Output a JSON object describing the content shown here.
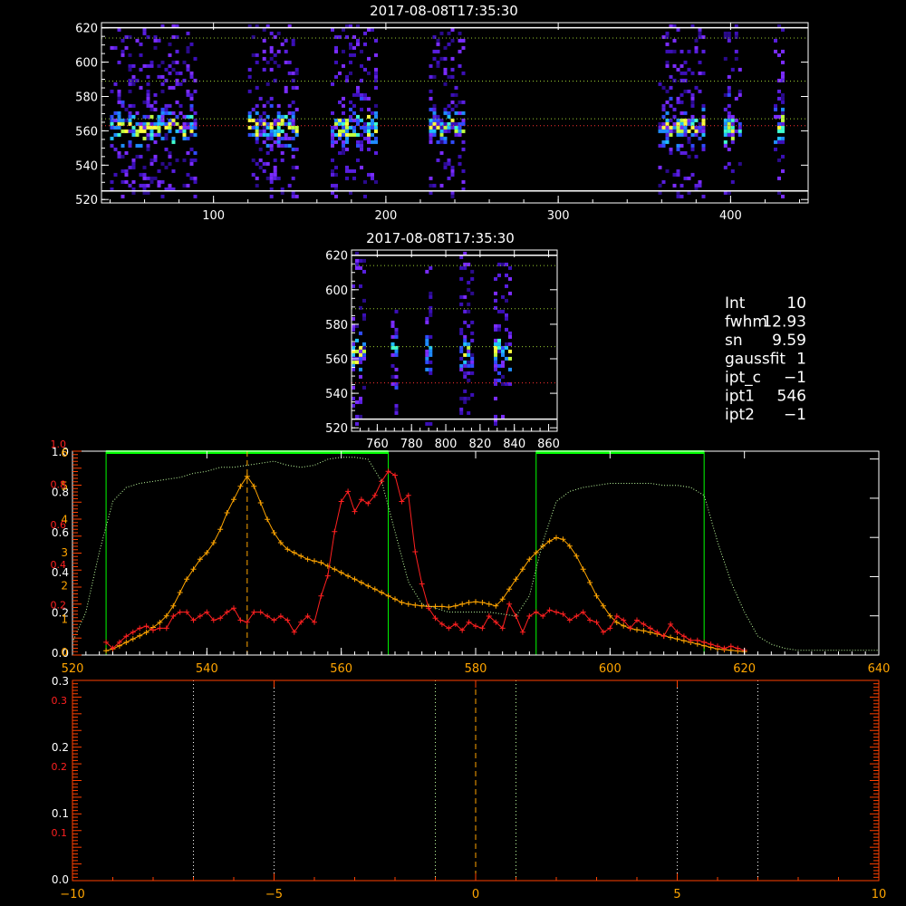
{
  "panel_top": {
    "title": "2017-08-08T17:35:30",
    "xticks": [
      "100",
      "200",
      "300",
      "400"
    ],
    "yticks": [
      "520",
      "540",
      "560",
      "580",
      "600",
      "620"
    ]
  },
  "panel_mid": {
    "title": "2017-08-08T17:35:30",
    "xticks": [
      "760",
      "780",
      "800",
      "820",
      "840",
      "860"
    ],
    "yticks": [
      "520",
      "540",
      "560",
      "580",
      "600",
      "620"
    ]
  },
  "fit_info": [
    {
      "key": "Int",
      "val": "10"
    },
    {
      "key": "fwhm",
      "val": "12.93"
    },
    {
      "key": "sn",
      "val": "9.59"
    },
    {
      "key": "gaussfit",
      "val": "1"
    },
    {
      "key": "ipt_c",
      "val": "−1"
    },
    {
      "key": "ipt1",
      "val": "546"
    },
    {
      "key": "ipt2",
      "val": "−1"
    }
  ],
  "colors": {
    "white": "#ffffff",
    "orange": "#ffa500",
    "red": "#ff2020",
    "green": "#00ff00",
    "lightgreen": "#c0ffa0",
    "axis_red": "#ff4000"
  },
  "chart_data": [
    {
      "type": "heatmap",
      "title": "2017-08-08T17:35:30",
      "xlim": [
        35,
        445
      ],
      "ylim": [
        518,
        623
      ],
      "signal_bands_x": [
        [
          40,
          90
        ],
        [
          120,
          148
        ],
        [
          168,
          195
        ],
        [
          225,
          245
        ],
        [
          358,
          385
        ],
        [
          396,
          405
        ],
        [
          425,
          430
        ]
      ],
      "horizontal_lines": {
        "white_solid": [
          620,
          525
        ],
        "green_dotted": [
          614,
          589,
          567
        ],
        "red_dotted": [
          563
        ]
      }
    },
    {
      "type": "heatmap",
      "title": "2017-08-08T17:35:30",
      "xlim": [
        745,
        865
      ],
      "ylim": [
        518,
        623
      ],
      "signal_bands_x": [
        [
          745,
          752
        ],
        [
          768,
          772
        ],
        [
          788,
          792
        ],
        [
          808,
          815
        ],
        [
          828,
          838
        ]
      ],
      "horizontal_lines": {
        "white_solid": [
          620,
          525
        ],
        "green_dotted": [
          614,
          589,
          567
        ],
        "red_dotted": [
          546
        ]
      }
    },
    {
      "type": "line",
      "xlim": [
        520,
        640
      ],
      "xticks": [
        "520",
        "540",
        "560",
        "580",
        "600",
        "620",
        "640"
      ],
      "left_axis_white": [
        "0.0",
        "0.2",
        "0.4",
        "0.6",
        "0.8",
        "1.0"
      ],
      "left_axis_orange": [
        "0",
        "1",
        "2",
        "3",
        "4",
        "5",
        "6"
      ],
      "left_axis_red": [
        "0.2",
        "0.4",
        "0.6",
        "0.8",
        "1.0"
      ],
      "vertical_green_lines": [
        525,
        567,
        589,
        614
      ],
      "vertical_orange_dashed": 546,
      "series": [
        {
          "color": "orange",
          "x": [
            525,
            526,
            527,
            528,
            529,
            530,
            531,
            532,
            533,
            534,
            535,
            536,
            537,
            538,
            539,
            540,
            541,
            542,
            543,
            544,
            545,
            546,
            547,
            548,
            549,
            550,
            551,
            552,
            553,
            554,
            555,
            556,
            557,
            558,
            559,
            560,
            561,
            562,
            563,
            564,
            565,
            566,
            567,
            568,
            569,
            570,
            571,
            572,
            573,
            574,
            575,
            576,
            577,
            578,
            579,
            580,
            581,
            582,
            583,
            584,
            585,
            586,
            587,
            588,
            589,
            590,
            591,
            592,
            593,
            594,
            595,
            596,
            597,
            598,
            599,
            600,
            601,
            602,
            603,
            604,
            605,
            606,
            607,
            608,
            609,
            610,
            611,
            612,
            613,
            614,
            615,
            616,
            617,
            618,
            619,
            620
          ],
          "y": [
            0.05,
            0.1,
            0.2,
            0.3,
            0.4,
            0.5,
            0.6,
            0.75,
            0.9,
            1.1,
            1.4,
            1.8,
            2.2,
            2.5,
            2.8,
            3.0,
            3.3,
            3.7,
            4.2,
            4.6,
            5.0,
            5.3,
            5.0,
            4.5,
            4.0,
            3.6,
            3.3,
            3.1,
            3.0,
            2.9,
            2.8,
            2.75,
            2.7,
            2.6,
            2.5,
            2.4,
            2.3,
            2.2,
            2.1,
            2.0,
            1.9,
            1.8,
            1.7,
            1.6,
            1.5,
            1.45,
            1.42,
            1.4,
            1.38,
            1.38,
            1.38,
            1.36,
            1.4,
            1.45,
            1.5,
            1.52,
            1.5,
            1.45,
            1.4,
            1.6,
            1.9,
            2.2,
            2.5,
            2.8,
            3.0,
            3.2,
            3.35,
            3.45,
            3.4,
            3.2,
            2.9,
            2.5,
            2.1,
            1.7,
            1.4,
            1.1,
            0.9,
            0.8,
            0.72,
            0.68,
            0.65,
            0.6,
            0.55,
            0.5,
            0.45,
            0.4,
            0.35,
            0.3,
            0.25,
            0.2,
            0.15,
            0.1,
            0.08,
            0.06,
            0.04,
            0.02
          ]
        },
        {
          "color": "red",
          "x": [
            525,
            526,
            527,
            528,
            529,
            530,
            531,
            532,
            533,
            534,
            535,
            536,
            537,
            538,
            539,
            540,
            541,
            542,
            543,
            544,
            545,
            546,
            547,
            548,
            549,
            550,
            551,
            552,
            553,
            554,
            555,
            556,
            557,
            558,
            559,
            560,
            561,
            562,
            563,
            564,
            565,
            566,
            567,
            568,
            569,
            570,
            571,
            572,
            573,
            574,
            575,
            576,
            577,
            578,
            579,
            580,
            581,
            582,
            583,
            584,
            585,
            586,
            587,
            588,
            589,
            590,
            591,
            592,
            593,
            594,
            595,
            596,
            597,
            598,
            599,
            600,
            601,
            602,
            603,
            604,
            605,
            606,
            607,
            608,
            609,
            610,
            611,
            612,
            613,
            614,
            615,
            616,
            617,
            618,
            619,
            620
          ],
          "y": [
            0.05,
            0.02,
            0.05,
            0.08,
            0.1,
            0.12,
            0.13,
            0.11,
            0.12,
            0.12,
            0.18,
            0.2,
            0.2,
            0.16,
            0.18,
            0.2,
            0.16,
            0.17,
            0.2,
            0.22,
            0.16,
            0.15,
            0.2,
            0.2,
            0.18,
            0.16,
            0.18,
            0.16,
            0.1,
            0.15,
            0.18,
            0.15,
            0.28,
            0.38,
            0.6,
            0.75,
            0.8,
            0.7,
            0.76,
            0.74,
            0.78,
            0.85,
            0.9,
            0.88,
            0.75,
            0.78,
            0.5,
            0.34,
            0.22,
            0.17,
            0.14,
            0.12,
            0.14,
            0.11,
            0.15,
            0.13,
            0.12,
            0.18,
            0.15,
            0.12,
            0.24,
            0.18,
            0.1,
            0.18,
            0.2,
            0.18,
            0.21,
            0.2,
            0.19,
            0.16,
            0.18,
            0.2,
            0.16,
            0.15,
            0.1,
            0.12,
            0.18,
            0.16,
            0.12,
            0.16,
            0.14,
            0.12,
            0.1,
            0.08,
            0.14,
            0.1,
            0.08,
            0.06,
            0.06,
            0.05,
            0.04,
            0.03,
            0.02,
            0.03,
            0.02,
            0.01
          ]
        },
        {
          "color": "lightgreen",
          "style": "dotted",
          "x": [
            520,
            522,
            524,
            526,
            528,
            530,
            532,
            534,
            536,
            538,
            540,
            542,
            544,
            546,
            548,
            550,
            552,
            554,
            556,
            558,
            560,
            562,
            564,
            566,
            568,
            570,
            572,
            574,
            576,
            578,
            580,
            582,
            584,
            586,
            588,
            590,
            592,
            594,
            596,
            598,
            600,
            602,
            604,
            606,
            608,
            610,
            612,
            614,
            616,
            618,
            620,
            622,
            624,
            626,
            628,
            630,
            632,
            634,
            636,
            638,
            640
          ],
          "y": [
            0.05,
            0.2,
            0.5,
            0.75,
            0.82,
            0.84,
            0.85,
            0.86,
            0.87,
            0.89,
            0.9,
            0.92,
            0.92,
            0.93,
            0.94,
            0.95,
            0.93,
            0.92,
            0.93,
            0.96,
            0.97,
            0.97,
            0.96,
            0.85,
            0.6,
            0.35,
            0.24,
            0.22,
            0.2,
            0.2,
            0.2,
            0.2,
            0.19,
            0.18,
            0.28,
            0.55,
            0.75,
            0.8,
            0.82,
            0.83,
            0.84,
            0.84,
            0.84,
            0.84,
            0.83,
            0.83,
            0.82,
            0.78,
            0.55,
            0.35,
            0.2,
            0.08,
            0.04,
            0.02,
            0.01,
            0.01,
            0.01,
            0.01,
            0.01,
            0.01,
            0.01
          ]
        }
      ]
    },
    {
      "type": "line",
      "xlim": [
        -10,
        10
      ],
      "xticks": [
        "−10",
        "−5",
        "0",
        "5",
        "10"
      ],
      "left_axis_white": [
        "0.0",
        "0.1",
        "0.2",
        "0.3"
      ],
      "left_axis_red": [
        "0.1",
        "0.2",
        "0.3"
      ],
      "vertical_dotted_white": [
        -7,
        -5,
        5,
        7
      ],
      "vertical_dotted_lightgreen": [
        -1,
        1
      ],
      "vertical_orange_dashed": 0,
      "series": []
    }
  ]
}
